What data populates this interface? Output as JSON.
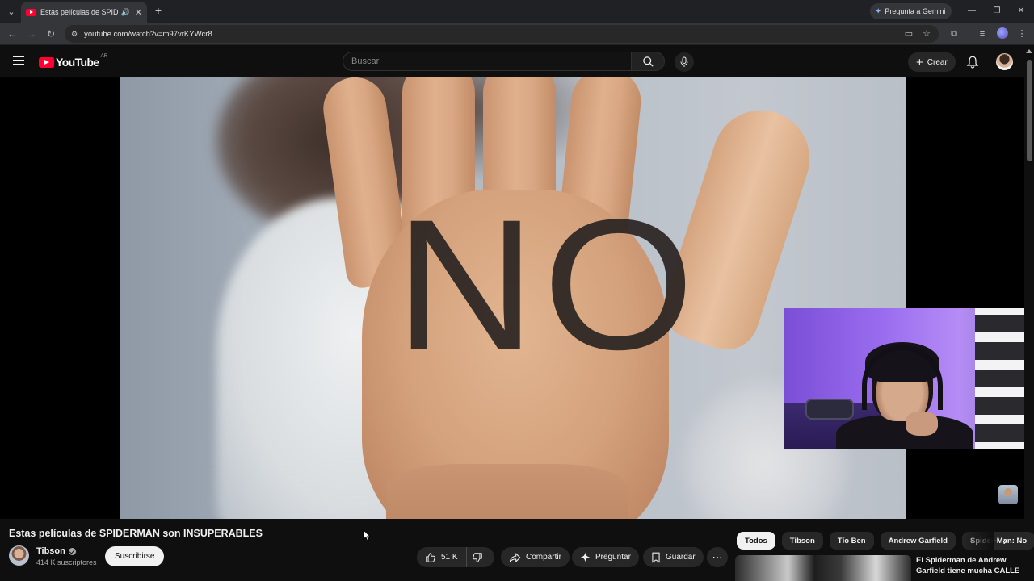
{
  "browser": {
    "tab_title": "Estas películas de SPIDERMAN son INSUPERABLES - YouTube",
    "gemini_label": "Pregunta a Gemini",
    "url": "youtube.com/watch?v=m97vrKYWcr8"
  },
  "yt_header": {
    "logo_text": "YouTube",
    "country": "AR",
    "search_placeholder": "Buscar",
    "create_label": "Crear"
  },
  "video": {
    "overlay_text": "NO",
    "title": "Estas películas de SPIDERMAN son INSUPERABLES"
  },
  "channel": {
    "name": "Tibson",
    "subscribers": "414 K suscriptores",
    "subscribe_label": "Suscribirse"
  },
  "actions": {
    "likes": "51 K",
    "share": "Compartir",
    "ask": "Preguntar",
    "save": "Guardar"
  },
  "chips": [
    "Todos",
    "Tibson",
    "Tío Ben",
    "Andrew Garfield",
    "Spider-Man: No"
  ],
  "recommendation": {
    "title": "El Spiderman de Andrew Garfield tiene mucha CALLE"
  },
  "colors": {
    "yt_red": "#ff0033",
    "background": "#0f0f0f",
    "chrome_tab": "#35363a"
  }
}
